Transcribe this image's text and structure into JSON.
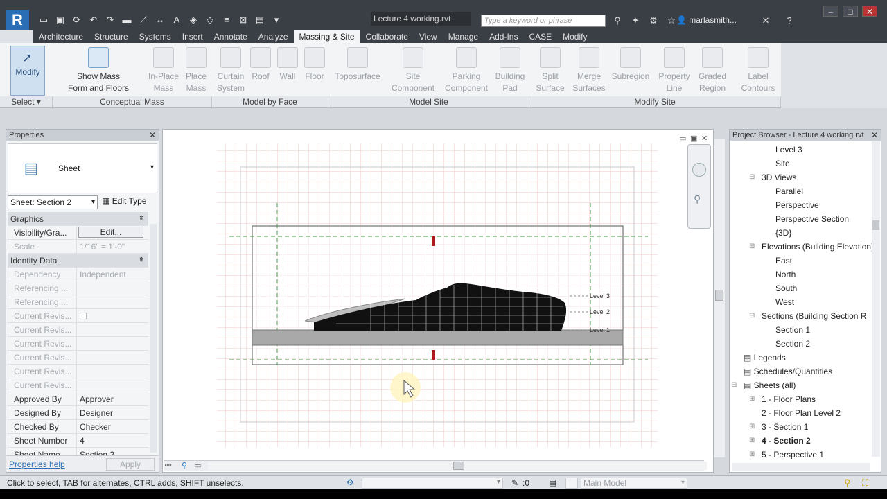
{
  "window": {
    "doc_title": "Lecture 4 working.rvt",
    "search_placeholder": "Type a keyword or phrase",
    "user": "marlasmith...",
    "app_logo": "R"
  },
  "tabs": [
    "Architecture",
    "Structure",
    "Systems",
    "Insert",
    "Annotate",
    "Analyze",
    "Massing & Site",
    "Collaborate",
    "View",
    "Manage",
    "Add-Ins",
    "CASE",
    "Modify"
  ],
  "active_tab": "Massing & Site",
  "ribbon": {
    "modify": "Modify",
    "show_mass_1": "Show Mass",
    "show_mass_2": "Form and Floors",
    "inplace_1": "In-Place",
    "inplace_2": "Mass",
    "placemass_1": "Place",
    "placemass_2": "Mass",
    "curtain_1": "Curtain",
    "curtain_2": "System",
    "roof": "Roof",
    "wall": "Wall",
    "floor": "Floor",
    "toposurface": "Toposurface",
    "site_comp_1": "Site",
    "site_comp_2": "Component",
    "parking_1": "Parking",
    "parking_2": "Component",
    "bpad_1": "Building",
    "bpad_2": "Pad",
    "split_1": "Split",
    "split_2": "Surface",
    "merge_1": "Merge",
    "merge_2": "Surfaces",
    "subregion": "Subregion",
    "propline_1": "Property",
    "propline_2": "Line",
    "graded_1": "Graded",
    "graded_2": "Region",
    "label_1": "Label",
    "label_2": "Contours",
    "panels": {
      "select": "Select",
      "conceptual": "Conceptual Mass",
      "byface": "Model by Face",
      "modelsite": "Model Site",
      "modifysite": "Modify Site"
    }
  },
  "properties": {
    "title": "Properties",
    "type_name": "Sheet",
    "instance_selector": "Sheet: Section 2",
    "edit_type": "Edit Type",
    "rows": [
      {
        "k": "Graphics",
        "v": "",
        "group": true
      },
      {
        "k": "Visibility/Gra...",
        "v": "Edit...",
        "button": true
      },
      {
        "k": "Scale",
        "v": "1/16\" = 1'-0\"",
        "grey": true
      },
      {
        "k": "Identity Data",
        "v": "",
        "group": true
      },
      {
        "k": "Dependency",
        "v": "Independent",
        "grey": true
      },
      {
        "k": "Referencing ...",
        "v": "",
        "grey": true
      },
      {
        "k": "Referencing ...",
        "v": "",
        "grey": true
      },
      {
        "k": "Current Revis...",
        "v": "",
        "grey": true,
        "check": true
      },
      {
        "k": "Current Revis...",
        "v": "",
        "grey": true
      },
      {
        "k": "Current Revis...",
        "v": "",
        "grey": true
      },
      {
        "k": "Current Revis...",
        "v": "",
        "grey": true
      },
      {
        "k": "Current Revis...",
        "v": "",
        "grey": true
      },
      {
        "k": "Current Revis...",
        "v": "",
        "grey": true
      },
      {
        "k": "Approved By",
        "v": "Approver"
      },
      {
        "k": "Designed By",
        "v": "Designer"
      },
      {
        "k": "Checked By",
        "v": "Checker"
      },
      {
        "k": "Sheet Number",
        "v": "4"
      },
      {
        "k": "Sheet Name",
        "v": "Section 2"
      }
    ],
    "help": "Properties help",
    "apply": "Apply"
  },
  "view": {
    "level_labels": [
      "Level 3",
      "Level 2",
      "Level 1"
    ]
  },
  "browser": {
    "title": "Project Browser - Lecture 4 working.rvt",
    "items": [
      {
        "t": "Level 3",
        "lvl": 2
      },
      {
        "t": "Site",
        "lvl": 2
      },
      {
        "t": "3D Views",
        "lvl": 1,
        "tog": "−"
      },
      {
        "t": "Parallel",
        "lvl": 2
      },
      {
        "t": "Perspective",
        "lvl": 2
      },
      {
        "t": "Perspective Section",
        "lvl": 2
      },
      {
        "t": "{3D}",
        "lvl": 2
      },
      {
        "t": "Elevations (Building Elevation)",
        "lvl": 1,
        "tog": "−"
      },
      {
        "t": "East",
        "lvl": 2
      },
      {
        "t": "North",
        "lvl": 2
      },
      {
        "t": "South",
        "lvl": 2
      },
      {
        "t": "West",
        "lvl": 2
      },
      {
        "t": "Sections (Building Section R",
        "lvl": 1,
        "tog": "−"
      },
      {
        "t": "Section 1",
        "lvl": 2
      },
      {
        "t": "Section 2",
        "lvl": 2
      },
      {
        "t": "Legends",
        "lvl": 0,
        "icon": true
      },
      {
        "t": "Schedules/Quantities",
        "lvl": 0,
        "icon": true
      },
      {
        "t": "Sheets (all)",
        "lvl": 0,
        "icon": true,
        "tog": "−"
      },
      {
        "t": "1 - Floor Plans",
        "lvl": 1,
        "tog": "+"
      },
      {
        "t": "2 - Floor Plan Level 2",
        "lvl": 1
      },
      {
        "t": "3 - Section 1",
        "lvl": 1,
        "tog": "+"
      },
      {
        "t": "4 - Section 2",
        "lvl": 1,
        "tog": "+",
        "bold": true
      },
      {
        "t": "5 - Perspective 1",
        "lvl": 1,
        "tog": "+"
      }
    ]
  },
  "status": {
    "text": "Click to select, TAB for alternates, CTRL adds, SHIFT unselects.",
    "zero": ":0",
    "model": "Main Model"
  }
}
